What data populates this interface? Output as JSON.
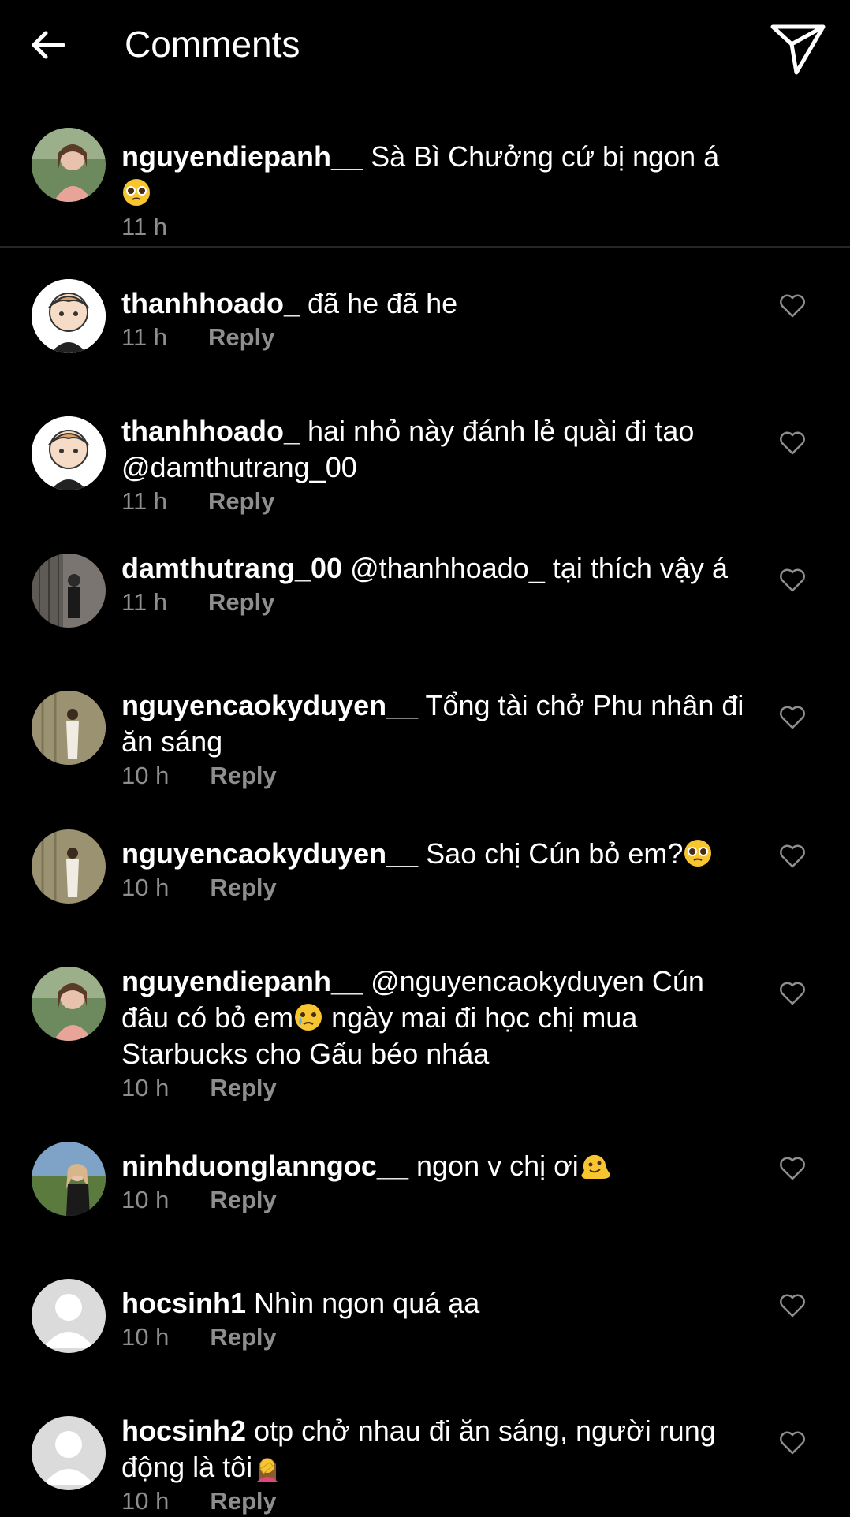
{
  "header": {
    "title": "Comments",
    "back_icon": "arrow-left-icon",
    "send_icon": "paper-plane-icon"
  },
  "caption": {
    "username": "nguyendiepanh__",
    "text": "Sà Bì Chưởng cứ bị ngon á",
    "emoji": "pleading-face",
    "time": "11 h"
  },
  "reply_label": "Reply",
  "comments": [
    {
      "username": "thanhhoado_",
      "text": "đã he đã he",
      "time": "11 h"
    },
    {
      "username": "thanhhoado_",
      "text": "hai nhỏ này đánh lẻ quài đi tao @damthutrang_00",
      "time": "11 h"
    },
    {
      "username": "damthutrang_00",
      "text": "@thanhhoado_ tại thích vậy á",
      "time": "11 h"
    },
    {
      "username": "nguyencaokyduyen__",
      "text": "Tổng tài chở Phu nhân đi ăn sáng",
      "time": "10 h"
    },
    {
      "username": "nguyencaokyduyen__",
      "text": "Sao chị Cún bỏ em?",
      "emoji": "pleading-face",
      "time": "10 h"
    },
    {
      "username": "nguyendiepanh__",
      "text_a": "@nguyencaokyduyen Cún đâu có bỏ em",
      "emoji": "crying-face",
      "text_b": " ngày mai đi học chị mua Starbucks cho Gấu béo nháa",
      "time": "10 h"
    },
    {
      "username": "ninhduonglanngoc__",
      "text": "ngon v chị ơi",
      "emoji": "melting-face",
      "time": "10 h"
    },
    {
      "username": "hocsinh1",
      "text": "Nhìn ngon quá ạa",
      "time": "10 h"
    },
    {
      "username": "hocsinh2",
      "text": "otp chở nhau đi ăn sáng, người rung động là tôi",
      "emoji": "woman-facepalming",
      "time": "10 h"
    }
  ],
  "colors": {
    "background": "#000000",
    "text": "#ffffff",
    "meta": "#8e8e8e",
    "divider": "#262626"
  }
}
